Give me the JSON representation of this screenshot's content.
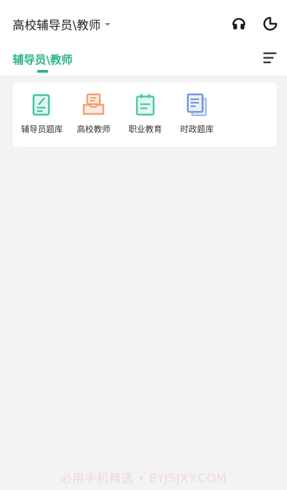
{
  "header": {
    "title": "高校辅导员\\教师"
  },
  "tabs": [
    {
      "label": "辅导员\\教师",
      "active": true
    }
  ],
  "grid_items": [
    {
      "label": "辅导员题库",
      "icon": "document-pencil-icon",
      "color": "#3cc2a2"
    },
    {
      "label": "高校教师",
      "icon": "folder-box-icon",
      "color": "#ef9f78"
    },
    {
      "label": "职业教育",
      "icon": "clipboard-icon",
      "color": "#4cc6a8"
    },
    {
      "label": "时政题库",
      "icon": "stacked-docs-icon",
      "color": "#6f97db"
    }
  ],
  "watermark": "必用手机精选 • BYJSJXY.COM",
  "colors": {
    "accent": "#2fb487",
    "background": "#f3f3f3"
  }
}
